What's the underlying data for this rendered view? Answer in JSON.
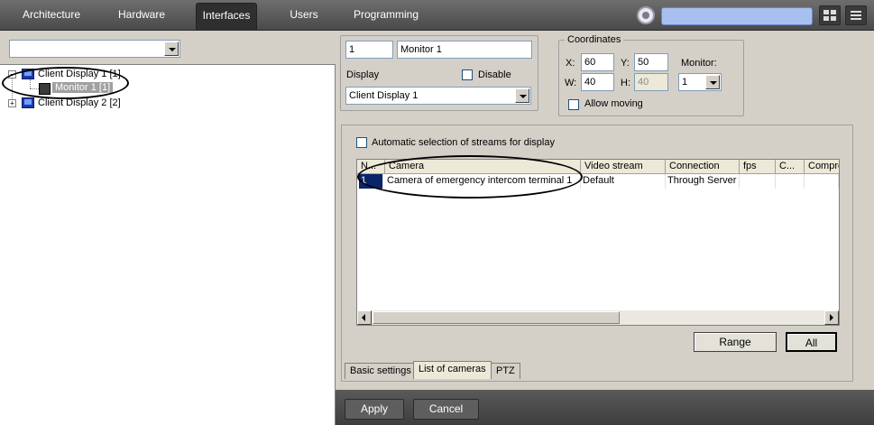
{
  "nav": {
    "tabs": [
      "Architecture",
      "Hardware",
      "Interfaces",
      "Users",
      "Programming"
    ],
    "active_tab": "Interfaces"
  },
  "tree": {
    "filter_value": "",
    "items": [
      {
        "label": "Client Display 1 [1]",
        "expanded": true
      },
      {
        "label": "Monitor 1 [1]",
        "selected": true
      },
      {
        "label": "Client Display 2 [2]",
        "expanded": false
      }
    ]
  },
  "monitor": {
    "id": "1",
    "name": "Monitor 1",
    "display_label": "Display",
    "disable_label": "Disable",
    "display_value": "Client Display 1"
  },
  "coordinates": {
    "title": "Coordinates",
    "x_label": "X:",
    "x": "60",
    "y_label": "Y:",
    "y": "50",
    "w_label": "W:",
    "w": "40",
    "h_label": "H:",
    "h": "40",
    "monitor_label": "Monitor:",
    "monitor": "1",
    "allow_moving_label": "Allow moving"
  },
  "cameras": {
    "auto_select_label": "Automatic selection of streams for display",
    "columns": [
      "N...",
      "Camera",
      "Video stream",
      "Connection",
      "fps",
      "C...",
      "Compre"
    ],
    "rows": [
      [
        "1",
        "Camera of emergency intercom terminal 1",
        "Default",
        "Through Server",
        "",
        "",
        ""
      ]
    ],
    "range_button": "Range",
    "all_button": "All"
  },
  "bottom_tabs": [
    "Basic settings",
    "List of cameras",
    "PTZ"
  ],
  "active_bottom_tab": "List of cameras",
  "actions": {
    "apply": "Apply",
    "cancel": "Cancel"
  },
  "colors": {
    "accent": "#0a246a",
    "search_bg": "#a8c0ef",
    "panel": "#d4d0c8"
  }
}
